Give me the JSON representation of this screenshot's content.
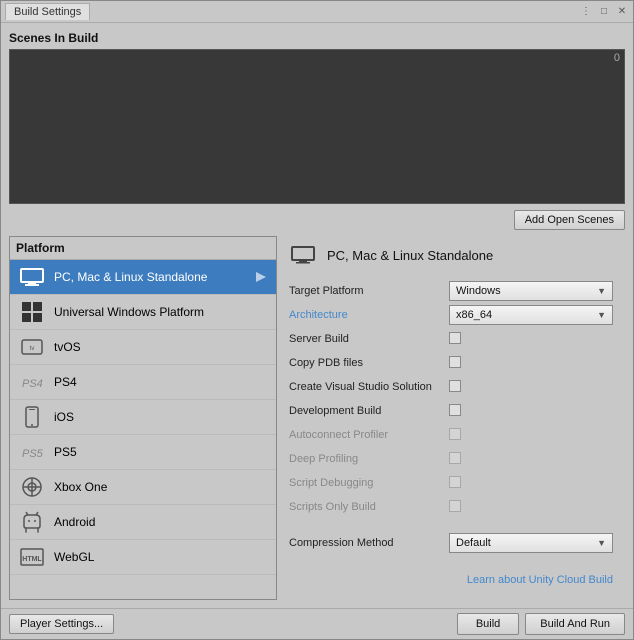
{
  "window": {
    "title": "Build Settings"
  },
  "titleControls": {
    "menu": "⋮",
    "maximize": "□",
    "close": "✕"
  },
  "scenesSection": {
    "title": "Scenes In Build",
    "count": "0",
    "addOpenScenesButton": "Add Open Scenes"
  },
  "platformSection": {
    "header": "Platform",
    "items": [
      {
        "id": "pc-mac-linux",
        "label": "PC, Mac & Linux Standalone",
        "selected": true,
        "iconType": "monitor"
      },
      {
        "id": "uwp",
        "label": "Universal Windows Platform",
        "selected": false,
        "iconType": "windows"
      },
      {
        "id": "tvos",
        "label": "tvOS",
        "selected": false,
        "iconType": "tvos"
      },
      {
        "id": "ps4",
        "label": "PS4",
        "selected": false,
        "iconType": "ps4"
      },
      {
        "id": "ios",
        "label": "iOS",
        "selected": false,
        "iconType": "ios"
      },
      {
        "id": "ps5",
        "label": "PS5",
        "selected": false,
        "iconType": "ps5"
      },
      {
        "id": "xbox",
        "label": "Xbox One",
        "selected": false,
        "iconType": "xbox"
      },
      {
        "id": "android",
        "label": "Android",
        "selected": false,
        "iconType": "android"
      },
      {
        "id": "webgl",
        "label": "WebGL",
        "selected": false,
        "iconType": "webgl"
      }
    ]
  },
  "settingsPanel": {
    "title": "PC, Mac & Linux Standalone",
    "rows": [
      {
        "id": "target-platform",
        "label": "Target Platform",
        "type": "dropdown",
        "value": "Windows",
        "isLink": false,
        "disabled": false
      },
      {
        "id": "architecture",
        "label": "Architecture",
        "type": "dropdown",
        "value": "x86_64",
        "isLink": true,
        "disabled": false
      },
      {
        "id": "server-build",
        "label": "Server Build",
        "type": "checkbox",
        "checked": false,
        "isLink": false,
        "disabled": false
      },
      {
        "id": "copy-pdb",
        "label": "Copy PDB files",
        "type": "checkbox",
        "checked": false,
        "isLink": false,
        "disabled": false
      },
      {
        "id": "vs-solution",
        "label": "Create Visual Studio Solution",
        "type": "checkbox",
        "checked": false,
        "isLink": false,
        "disabled": false
      },
      {
        "id": "dev-build",
        "label": "Development Build",
        "type": "checkbox",
        "checked": false,
        "isLink": false,
        "disabled": false
      },
      {
        "id": "autoconnect",
        "label": "Autoconnect Profiler",
        "type": "checkbox",
        "checked": false,
        "isLink": false,
        "disabled": true
      },
      {
        "id": "deep-profiling",
        "label": "Deep Profiling",
        "type": "checkbox",
        "checked": false,
        "isLink": false,
        "disabled": true
      },
      {
        "id": "script-debug",
        "label": "Script Debugging",
        "type": "checkbox",
        "checked": false,
        "isLink": false,
        "disabled": true
      },
      {
        "id": "scripts-only",
        "label": "Scripts Only Build",
        "type": "checkbox",
        "checked": false,
        "isLink": false,
        "disabled": true
      }
    ],
    "compressionLabel": "Compression Method",
    "compressionValue": "Default",
    "cloudBuildLink": "Learn about Unity Cloud Build"
  },
  "bottomBar": {
    "playerSettingsButton": "Player Settings...",
    "buildButton": "Build",
    "buildAndRunButton": "Build And Run"
  }
}
